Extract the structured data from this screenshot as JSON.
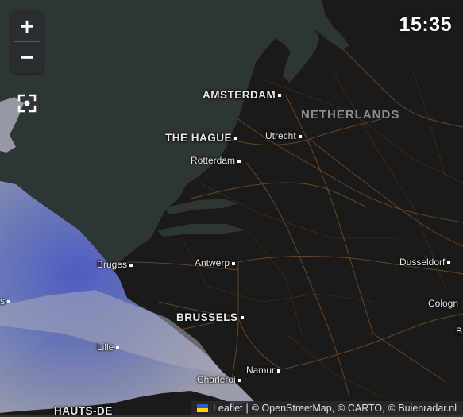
{
  "clock": "15:35",
  "zoom": {
    "in_label": "+",
    "out_label": "−"
  },
  "map": {
    "country_label": "NETHERLANDS",
    "cities": [
      {
        "id": "amsterdam",
        "label": "AMSTERDAM",
        "major": true
      },
      {
        "id": "the-hague",
        "label": "THE HAGUE",
        "major": true
      },
      {
        "id": "utrecht",
        "label": "Utrecht",
        "major": false
      },
      {
        "id": "rotterdam",
        "label": "Rotterdam",
        "major": false
      },
      {
        "id": "bruges",
        "label": "Bruges",
        "major": false
      },
      {
        "id": "antwerp",
        "label": "Antwerp",
        "major": false
      },
      {
        "id": "dusseldorf",
        "label": "Dusseldorf",
        "major": false
      },
      {
        "id": "cologne",
        "label": "Cologn",
        "major": false
      },
      {
        "id": "brussels",
        "label": "BRUSSELS",
        "major": true
      },
      {
        "id": "lille",
        "label": "Lille",
        "major": false
      },
      {
        "id": "namur",
        "label": "Namur",
        "major": false
      },
      {
        "id": "charleroi",
        "label": "Charleroi",
        "major": false
      },
      {
        "id": "hauts-de-france",
        "label": "HAUTS-DE",
        "major": true
      },
      {
        "id": "edge-b",
        "label": "B",
        "major": false
      },
      {
        "id": "edge-s",
        "label": "s",
        "major": false
      }
    ]
  },
  "attribution": {
    "leaflet": "Leaflet",
    "separator": "|",
    "osm": "© OpenStreetMap,",
    "carto": "© CARTO,",
    "buienradar": "© Buienradar.nl"
  },
  "colors": {
    "sea": "#2d3535",
    "land": "#1c1a18",
    "roads": "#6e4e2c",
    "rain_light": "#a9aab8",
    "rain_medium": "#6f7bc4",
    "rain_heavy": "#4d5cc4"
  }
}
